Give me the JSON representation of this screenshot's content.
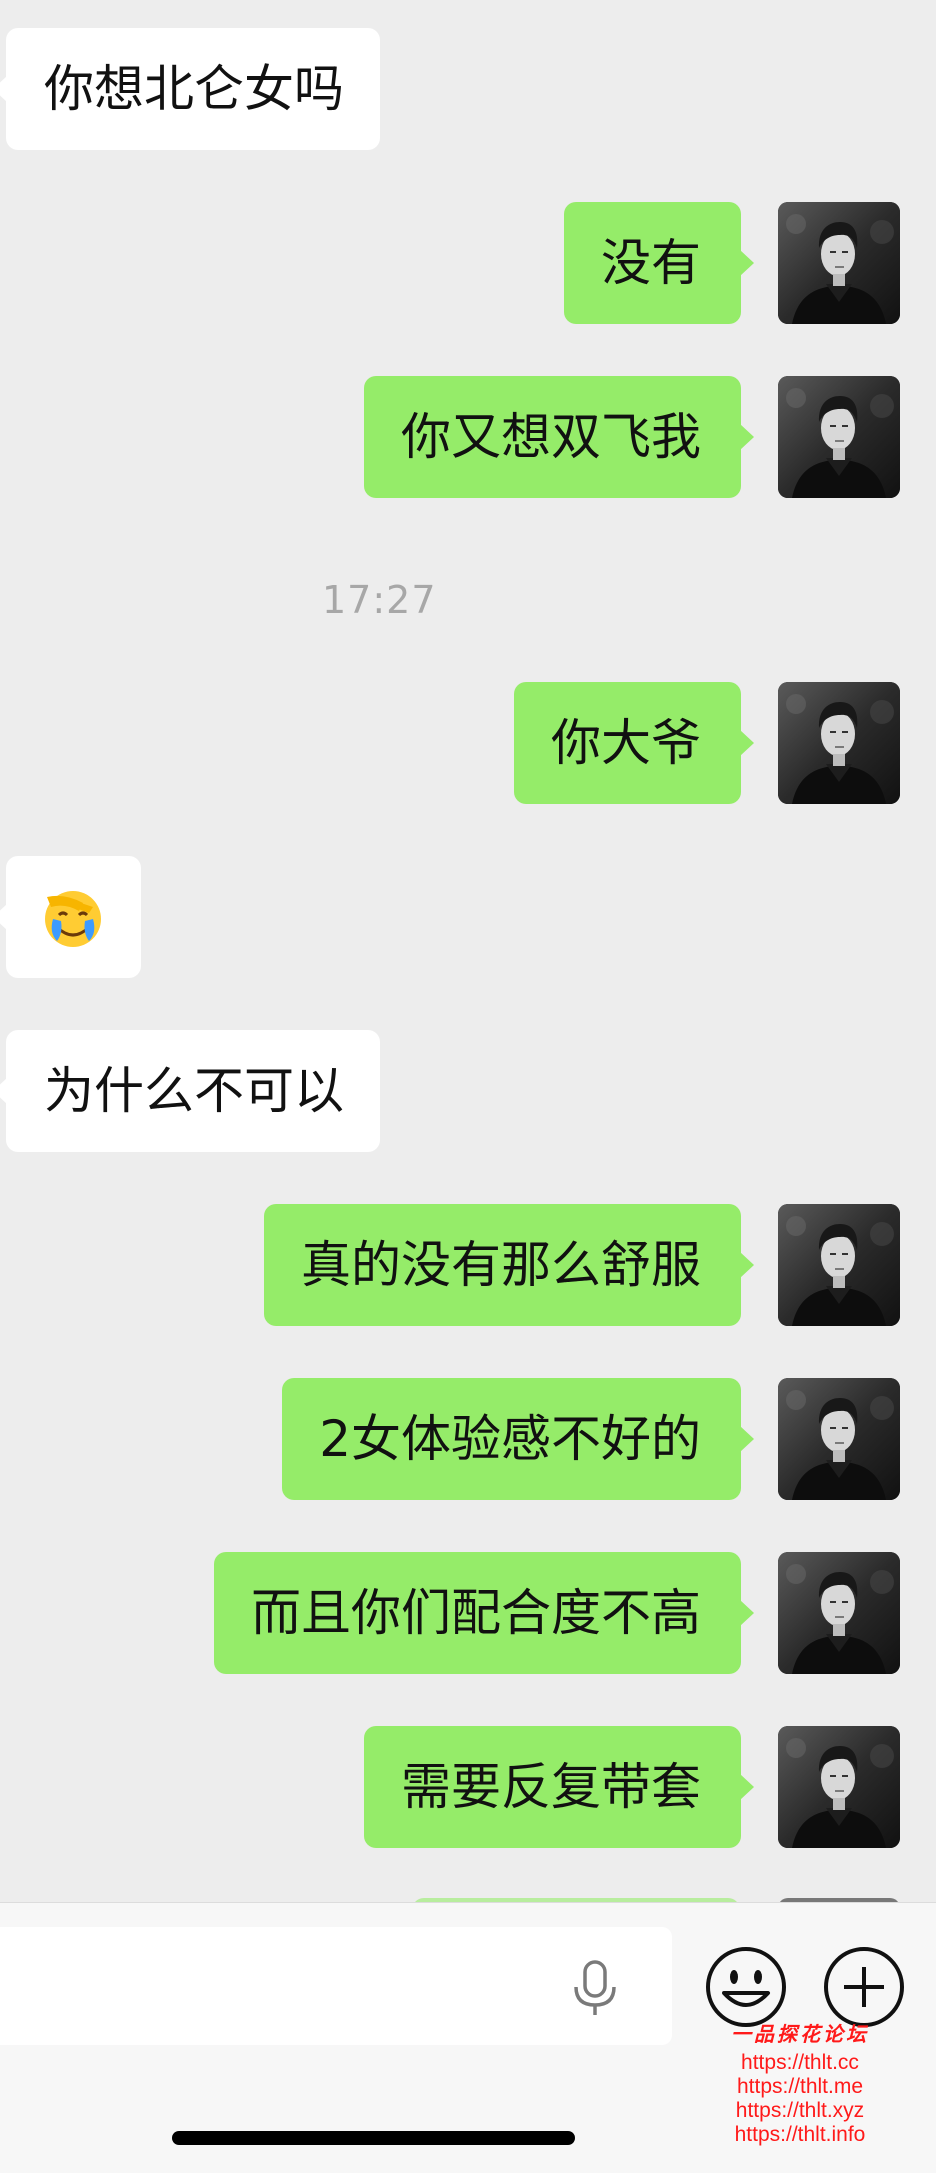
{
  "messages": [
    {
      "side": "in",
      "text": "你想北仑女吗"
    },
    {
      "side": "out",
      "text": "没有"
    },
    {
      "side": "out",
      "text": "你又想双飞我"
    },
    {
      "side": "out",
      "text": "你大爷"
    },
    {
      "side": "in",
      "icon": "facepalm-crying-emoji"
    },
    {
      "side": "in",
      "text": "为什么不可以"
    },
    {
      "side": "out",
      "text": "真的没有那么舒服"
    },
    {
      "side": "out",
      "text": "2女体验感不好的"
    },
    {
      "side": "out",
      "text": "而且你们配合度不高"
    },
    {
      "side": "out",
      "text": "需要反复带套"
    }
  ],
  "timestamp": "17:27",
  "input_bar": {
    "mic_icon": "microphone-icon",
    "emoji_icon": "smiley-icon",
    "plus_icon": "plus-circle-icon"
  },
  "watermark": {
    "title": "一品探花论坛",
    "links": [
      "https://thlt.cc",
      "https://thlt.me",
      "https://thlt.xyz",
      "https://thlt.info"
    ]
  },
  "colors": {
    "background": "#ededed",
    "incoming_bubble": "#ffffff",
    "outgoing_bubble": "#95ec69",
    "watermark": "#ff1a1a"
  }
}
